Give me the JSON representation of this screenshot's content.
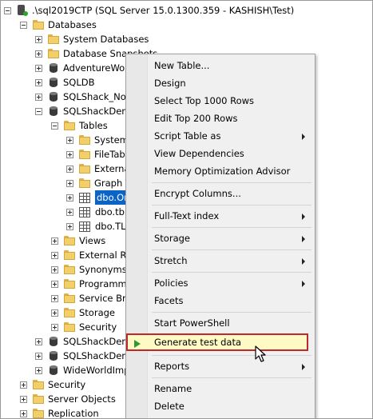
{
  "tree": {
    "server": ".\\sql2019CTP (SQL Server 15.0.1300.359 - KASHISH\\Test)",
    "databases": "Databases",
    "system_databases": "System Databases",
    "database_snapshots": "Database Snapshots",
    "adventureworks": "AdventureWor",
    "sqldb": "SQLDB",
    "sqlshack_nor": "SQLShack_NoR",
    "sqlshackdem1": "SQLShackDem",
    "tables": "Tables",
    "system_tables": "System",
    "filetables": "FileTab",
    "external_tables": "Externa",
    "graph_tables": "Graph T",
    "dbo_orders": "dbo.Ord",
    "dbo_tbl": "dbo.tbl",
    "dbo_tl": "dbo.TLe",
    "views": "Views",
    "external_resources": "External Re",
    "synonyms": "Synonyms",
    "programmability": "Programm",
    "service_broker": "Service Bro",
    "storage": "Storage",
    "security_db": "Security",
    "sqlshackdem2": "SQLShackDem",
    "sqlshackdem3": "SQLShackDem",
    "wideworldimporters": "WideWorldImp",
    "security": "Security",
    "server_objects": "Server Objects",
    "replication": "Replication"
  },
  "menu": {
    "new_table": "New Table...",
    "design": "Design",
    "select_top": "Select Top 1000 Rows",
    "edit_top": "Edit Top 200 Rows",
    "script_table_as": "Script Table as",
    "view_dependencies": "View Dependencies",
    "memory_opt": "Memory Optimization Advisor",
    "encrypt_columns": "Encrypt Columns...",
    "fulltext_index": "Full-Text index",
    "storage": "Storage",
    "stretch": "Stretch",
    "policies": "Policies",
    "facets": "Facets",
    "start_powershell": "Start PowerShell",
    "generate_test_data": "Generate test data",
    "reports": "Reports",
    "rename": "Rename",
    "delete": "Delete"
  },
  "colors": {
    "selection": "#0a64c8",
    "highlight_border": "#c0282d",
    "highlight_fill": "#fff9c4",
    "play_icon": "#2f9a2f"
  },
  "icons": [
    "server-icon",
    "folder-icon",
    "database-icon",
    "table-icon",
    "play-icon",
    "submenu-arrow-icon",
    "mouse-cursor-icon"
  ]
}
